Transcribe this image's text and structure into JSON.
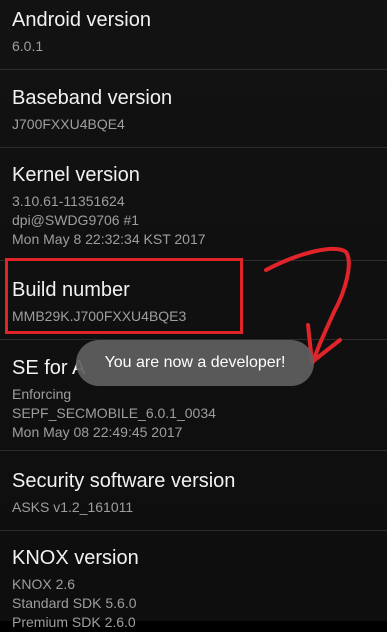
{
  "settings": {
    "items": [
      {
        "title": "Android version",
        "lines": [
          "6.0.1"
        ]
      },
      {
        "title": "Baseband version",
        "lines": [
          "J700FXXU4BQE4"
        ]
      },
      {
        "title": "Kernel version",
        "lines": [
          "3.10.61-11351624",
          "dpi@SWDG9706 #1",
          "Mon May 8 22:32:34 KST 2017"
        ]
      },
      {
        "title": "Build number",
        "lines": [
          "MMB29K.J700FXXU4BQE3"
        ]
      },
      {
        "title": "SE for A",
        "lines": [
          "Enforcing",
          "SEPF_SECMOBILE_6.0.1_0034",
          "Mon May 08 22:49:45 2017"
        ]
      },
      {
        "title": "Security software version",
        "lines": [
          "ASKS v1.2_161011"
        ]
      },
      {
        "title": "KNOX version",
        "lines": [
          "KNOX 2.6",
          "Standard SDK 5.6.0",
          "Premium SDK 2.6.0"
        ]
      }
    ]
  },
  "toast": {
    "message": "You are now a developer!"
  },
  "annotation": {
    "color": "#e0242a"
  }
}
